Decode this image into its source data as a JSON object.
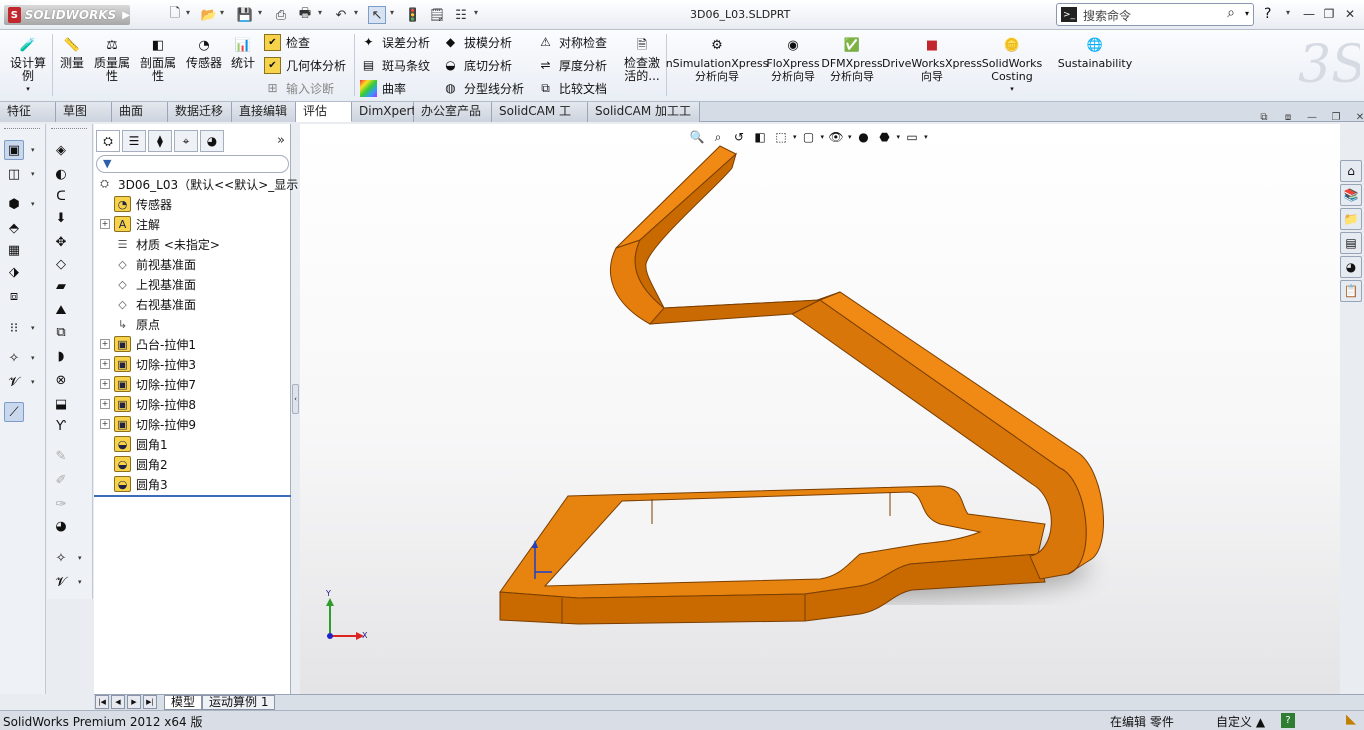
{
  "app": {
    "logo_text": "SOLIDWORKS",
    "document_title": "3D06_L03.SLDPRT",
    "search_placeholder": "搜索命令"
  },
  "ribbon": {
    "large": [
      {
        "label": "设计算例",
        "icon": "design-study-icon"
      },
      {
        "label": "测量",
        "icon": "measure-icon"
      },
      {
        "label": "质量属性",
        "icon": "mass-properties-icon"
      },
      {
        "label": "剖面属性",
        "icon": "section-properties-icon"
      },
      {
        "label": "传感器",
        "icon": "sensor-icon"
      },
      {
        "label": "统计",
        "icon": "statistics-icon"
      }
    ],
    "small_col1": [
      {
        "label": "检查",
        "enabled": true
      },
      {
        "label": "几何体分析",
        "enabled": true
      },
      {
        "label": "输入诊断",
        "enabled": false
      }
    ],
    "small_col2": [
      "误差分析",
      "斑马条纹",
      "曲率"
    ],
    "small_col3": [
      "拔模分析",
      "底切分析",
      "分型线分析"
    ],
    "small_col4": [
      "对称检查",
      "厚度分析",
      "比较文档"
    ],
    "check_active": "检查激活的...",
    "addins": [
      {
        "line1": "nSimulationXpress",
        "line2": "分析向导"
      },
      {
        "line1": "FloXpress",
        "line2": "分析向导"
      },
      {
        "line1": "DFMXpress",
        "line2": "分析向导"
      },
      {
        "line1": "DriveWorksXpress",
        "line2": "向导"
      },
      {
        "line1": "SolidWorks",
        "line2": "Costing"
      },
      {
        "line1": "Sustainability",
        "line2": ""
      }
    ]
  },
  "tabs": [
    "特征",
    "草图",
    "曲面",
    "数据迁移",
    "直接编辑",
    "评估",
    "DimXpert",
    "办公室产品",
    "SolidCAM 工件",
    "SolidCAM 加工工程"
  ],
  "active_tab": "评估",
  "feature_tree": {
    "root": "3D06_L03（默认<<默认>_显示",
    "items": [
      {
        "label": "传感器",
        "expandable": false
      },
      {
        "label": "注解",
        "expandable": true
      },
      {
        "label": "材质 <未指定>",
        "expandable": false
      },
      {
        "label": "前视基准面",
        "expandable": false
      },
      {
        "label": "上视基准面",
        "expandable": false
      },
      {
        "label": "右视基准面",
        "expandable": false
      },
      {
        "label": "原点",
        "expandable": false
      },
      {
        "label": "凸台-拉伸1",
        "expandable": true
      },
      {
        "label": "切除-拉伸3",
        "expandable": true
      },
      {
        "label": "切除-拉伸7",
        "expandable": true
      },
      {
        "label": "切除-拉伸8",
        "expandable": true
      },
      {
        "label": "切除-拉伸9",
        "expandable": true
      },
      {
        "label": "圆角1",
        "expandable": false
      },
      {
        "label": "圆角2",
        "expandable": false
      },
      {
        "label": "圆角3",
        "expandable": false
      }
    ]
  },
  "bottom_tabs": [
    "模型",
    "运动算例 1"
  ],
  "status": {
    "app_version": "SolidWorks Premium 2012 x64 版",
    "edit_mode": "在编辑 零件",
    "units": "自定义 ▲"
  },
  "axes": {
    "x": "X",
    "y": "Y"
  },
  "colors": {
    "part": "#e07b00",
    "part_dark": "#a85400",
    "part_light": "#f39a2a"
  }
}
